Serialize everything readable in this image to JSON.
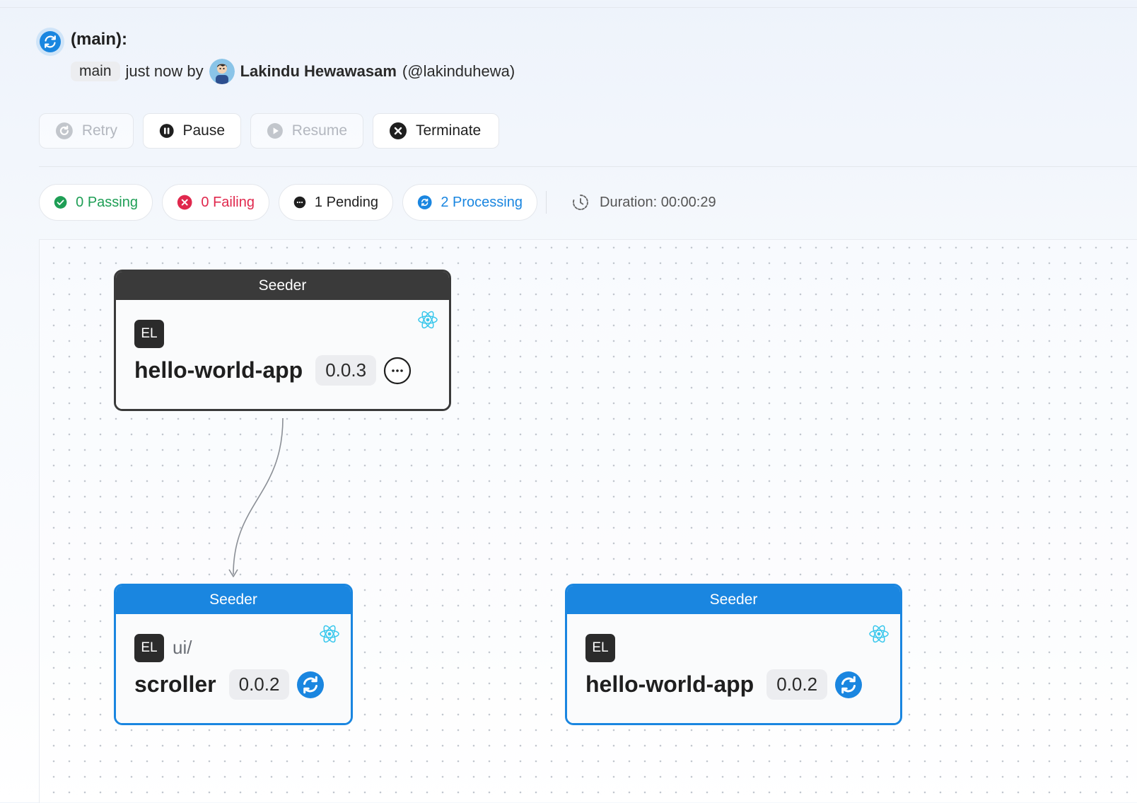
{
  "header": {
    "title": "(main):",
    "branch": "main",
    "time_text": "just now by",
    "author_name": "Lakindu Hewawasam",
    "author_handle": "(@lakinduhewa)"
  },
  "actions": {
    "retry": "Retry",
    "pause": "Pause",
    "resume": "Resume",
    "terminate": "Terminate"
  },
  "summary": {
    "passing": "0 Passing",
    "failing": "0 Failing",
    "pending": "1 Pending",
    "processing": "2 Processing",
    "duration": "Duration: 00:00:29"
  },
  "colors": {
    "passing": "#1e9e55",
    "failing": "#e0284d",
    "pending": "#2b2b2b",
    "processing": "#1a86e0",
    "node_dark": "#3a3a3a",
    "node_blue": "#1a86e0"
  },
  "graph": {
    "nodes": [
      {
        "task": "Seeder",
        "owner": "EL",
        "scope": "",
        "name": "hello-world-app",
        "version": "0.0.3",
        "status": "pending",
        "status_icon": "ellipsis-icon",
        "framework_icon": "react-icon"
      },
      {
        "task": "Seeder",
        "owner": "EL",
        "scope": "ui/",
        "name": "scroller",
        "version": "0.0.2",
        "status": "processing",
        "status_icon": "sync-icon",
        "framework_icon": "react-icon"
      },
      {
        "task": "Seeder",
        "owner": "EL",
        "scope": "",
        "name": "hello-world-app",
        "version": "0.0.2",
        "status": "processing",
        "status_icon": "sync-icon",
        "framework_icon": "react-icon"
      }
    ],
    "edges": [
      {
        "from": "hello-world-app@0.0.3",
        "to": "ui/scroller@0.0.2"
      }
    ]
  }
}
